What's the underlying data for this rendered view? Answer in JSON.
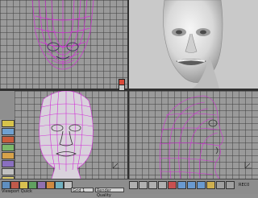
{
  "viewports": {
    "front": {
      "label": ""
    },
    "perspective": {
      "label": ""
    },
    "camera": {
      "label": ""
    },
    "side": {
      "label": ""
    }
  },
  "bottom_bar": {
    "left_label": "Viewport Quick",
    "field_1": "Grid 1",
    "field_2": "Render Quality",
    "right_status": "REC0"
  },
  "colors": {
    "wireframe": "#d12fd6",
    "grid_bg": "#9a9a9a",
    "shade_bg": "#c9c9c9"
  }
}
